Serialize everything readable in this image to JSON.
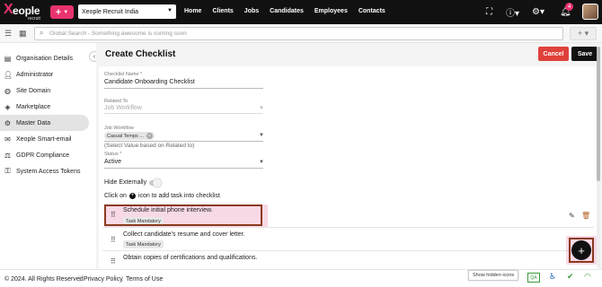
{
  "brand": {
    "logo_mark": "X",
    "logo_word": "eople",
    "logo_sub": "recruit"
  },
  "topbar": {
    "plus_label": "+",
    "org_select": "Xeople Recruit India",
    "nav": [
      "Home",
      "Clients",
      "Jobs",
      "Candidates",
      "Employees",
      "Contacts"
    ],
    "notification_count": "4",
    "icons": [
      "fullscreen-icon",
      "help-icon",
      "settings-icon",
      "bell-icon",
      "avatar"
    ]
  },
  "search": {
    "placeholder": "Global Search - Something awesome is coming soon"
  },
  "sidebar": {
    "items": [
      {
        "label": "Organisation Details",
        "icon": "building-icon"
      },
      {
        "label": "Administrator",
        "icon": "user-icon"
      },
      {
        "label": "Site Domain",
        "icon": "globe-icon"
      },
      {
        "label": "Marketplace",
        "icon": "diamond-icon"
      },
      {
        "label": "Master Data",
        "icon": "gear-icon"
      },
      {
        "label": "Xeople Smart-email",
        "icon": "email-icon"
      },
      {
        "label": "GDPR Compliance",
        "icon": "gdpr-icon"
      },
      {
        "label": "System Access Tokens",
        "icon": "key-icon"
      }
    ],
    "active_index": 4
  },
  "page": {
    "title": "Create Checklist",
    "cancel_label": "Cancel",
    "save_label": "Save"
  },
  "form": {
    "checklist_name_label": "Checklist Name *",
    "checklist_name_value": "Candidate Onboarding Checklist",
    "related_to_label": "Related To",
    "related_to_value": "Job Workflow",
    "job_workflow_label": "Job Workflow",
    "job_workflow_chip": "Casual Temps ...",
    "job_workflow_helper": "(Select Value based on Related to)",
    "status_label": "Status *",
    "status_value": "Active",
    "hide_externally_label": "Hide Externally",
    "hide_externally_on": false,
    "instruction_prefix": "Click on",
    "instruction_suffix": "icon to add task into checklist"
  },
  "tasks": [
    {
      "title": "Schedule initial phone interview.",
      "tag": "Task Mandatory"
    },
    {
      "title": "Collect candidate's resume and cover letter.",
      "tag": "Task Mandatory"
    },
    {
      "title": "Obtain copies of certifications and qualifications.",
      "tag": ""
    }
  ],
  "footer": {
    "copyright": "© 2024. All Rights Reserved",
    "privacy": "Privacy Policy",
    "terms": "Terms of Use",
    "tooltip": "Show hidden icons",
    "qa_badge": "QA"
  }
}
